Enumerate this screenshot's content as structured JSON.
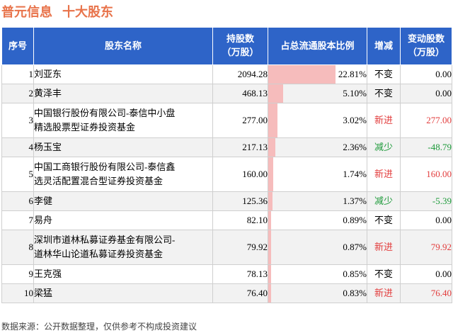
{
  "header": {
    "company": "普元信息",
    "section": "十大股东"
  },
  "columns": {
    "rank": "序号",
    "name": "股东名称",
    "shares_line1": "持股数",
    "shares_line2": "（万股）",
    "ratio": "占总流通股本比例",
    "change": "增减",
    "delta_line1": "变动股数",
    "delta_line2": "（万股）"
  },
  "colors": {
    "header_bg": "#2e64c8",
    "bar": "#f6bcbc",
    "increase": "#e23c3c",
    "decrease": "#1d9a3a",
    "title": "#e8734a"
  },
  "chart_data": {
    "type": "table",
    "title": "普元信息 十大股东",
    "rows": [
      {
        "rank": "1",
        "name_lines": [
          "刘亚东"
        ],
        "shares": "2094.28",
        "ratio": 22.81,
        "ratio_label": "22.81%",
        "change": "不变",
        "change_type": "flat",
        "delta": "0.00"
      },
      {
        "rank": "2",
        "name_lines": [
          "黄泽丰"
        ],
        "shares": "468.13",
        "ratio": 5.1,
        "ratio_label": "5.10%",
        "change": "不变",
        "change_type": "flat",
        "delta": "0.00"
      },
      {
        "rank": "3",
        "name_lines": [
          "中国银行股份有限公司-泰信中小盘",
          "精选股票型证券投资基金"
        ],
        "shares": "277.00",
        "ratio": 3.02,
        "ratio_label": "3.02%",
        "change": "新进",
        "change_type": "up",
        "delta": "277.00"
      },
      {
        "rank": "4",
        "name_lines": [
          "杨玉宝"
        ],
        "shares": "217.13",
        "ratio": 2.36,
        "ratio_label": "2.36%",
        "change": "减少",
        "change_type": "down",
        "delta": "-48.79"
      },
      {
        "rank": "5",
        "name_lines": [
          "中国工商银行股份有限公司-泰信鑫",
          "选灵活配置混合型证券投资基金"
        ],
        "shares": "160.00",
        "ratio": 1.74,
        "ratio_label": "1.74%",
        "change": "新进",
        "change_type": "up",
        "delta": "160.00"
      },
      {
        "rank": "6",
        "name_lines": [
          "李健"
        ],
        "shares": "125.36",
        "ratio": 1.37,
        "ratio_label": "1.37%",
        "change": "减少",
        "change_type": "down",
        "delta": "-5.39"
      },
      {
        "rank": "7",
        "name_lines": [
          "易舟"
        ],
        "shares": "82.10",
        "ratio": 0.89,
        "ratio_label": "0.89%",
        "change": "不变",
        "change_type": "flat",
        "delta": "0.00"
      },
      {
        "rank": "8",
        "name_lines": [
          "深圳市道林私募证券基金有限公司-",
          "道林华山论道私募证券投资基金"
        ],
        "shares": "79.92",
        "ratio": 0.87,
        "ratio_label": "0.87%",
        "change": "新进",
        "change_type": "up",
        "delta": "79.92"
      },
      {
        "rank": "9",
        "name_lines": [
          "王克强"
        ],
        "shares": "78.13",
        "ratio": 0.85,
        "ratio_label": "0.85%",
        "change": "不变",
        "change_type": "flat",
        "delta": "0.00"
      },
      {
        "rank": "10",
        "name_lines": [
          "梁猛"
        ],
        "shares": "76.40",
        "ratio": 0.83,
        "ratio_label": "0.83%",
        "change": "新进",
        "change_type": "up",
        "delta": "76.40"
      }
    ]
  },
  "footer": {
    "source": "数据来源：公开数据整理，仅供参考不构成投资建议"
  }
}
